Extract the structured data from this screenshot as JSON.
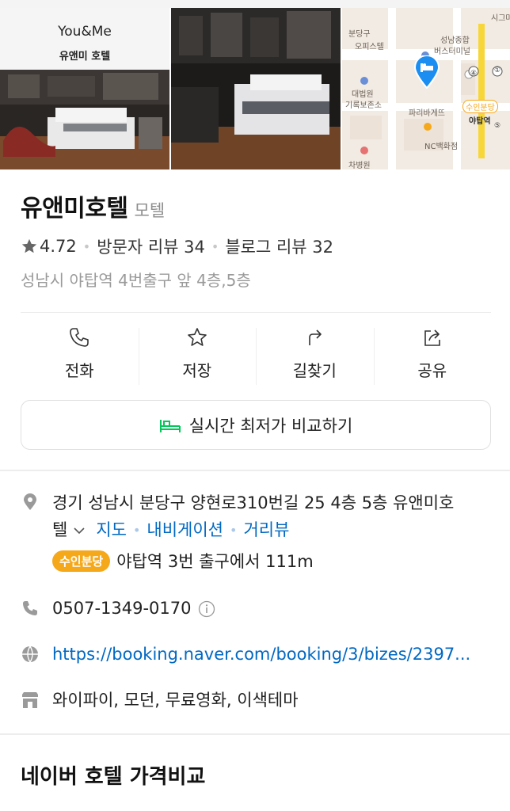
{
  "gallery": {
    "brand_en": "You&Me",
    "brand_ko": "유앤미 호텔",
    "map_labels": [
      "수인분당",
      "야탑역",
      "파리바게뜨",
      "NC백화점",
      "차병원",
      "대법원",
      "기록보존소",
      "분당구",
      "오피스텔",
      "성남종합",
      "버스터미널",
      "시그마",
      "④",
      "①",
      "⑤"
    ]
  },
  "place": {
    "name": "유앤미호텔",
    "category": "모텔",
    "rating": "4.72",
    "visitor_reviews": "방문자 리뷰 34",
    "blog_reviews": "블로그 리뷰 32",
    "short_address": "성남시 야탑역 4번출구 앞 4층,5층"
  },
  "actions": [
    {
      "label": "전화",
      "icon": "phone-icon"
    },
    {
      "label": "저장",
      "icon": "star-icon"
    },
    {
      "label": "길찾기",
      "icon": "directions-icon"
    },
    {
      "label": "공유",
      "icon": "share-icon"
    }
  ],
  "compare_button": {
    "label": "실시간 최저가 비교하기",
    "icon": "bed-icon"
  },
  "info": {
    "address_line1": "경기 성남시 분당구 양현로310번길 25 4층 5층 유앤미호",
    "address_line2": "텔",
    "map_link": "지도",
    "navi_link": "내비게이션",
    "street_link": "거리뷰",
    "subway_badge": "수인분당",
    "subway_text": "야탑역 3번 출구에서 111m",
    "phone": "0507-1349-0170",
    "url": "https://booking.naver.com/booking/3/bizes/2397...",
    "amenities": "와이파이, 모던, 무료영화, 이색테마"
  },
  "section": {
    "title": "네이버 호텔 가격비교"
  },
  "colors": {
    "link": "#0068c3",
    "subway": "#f6a81b",
    "green_icon": "#03c75a",
    "muted": "#9a9a9a"
  }
}
